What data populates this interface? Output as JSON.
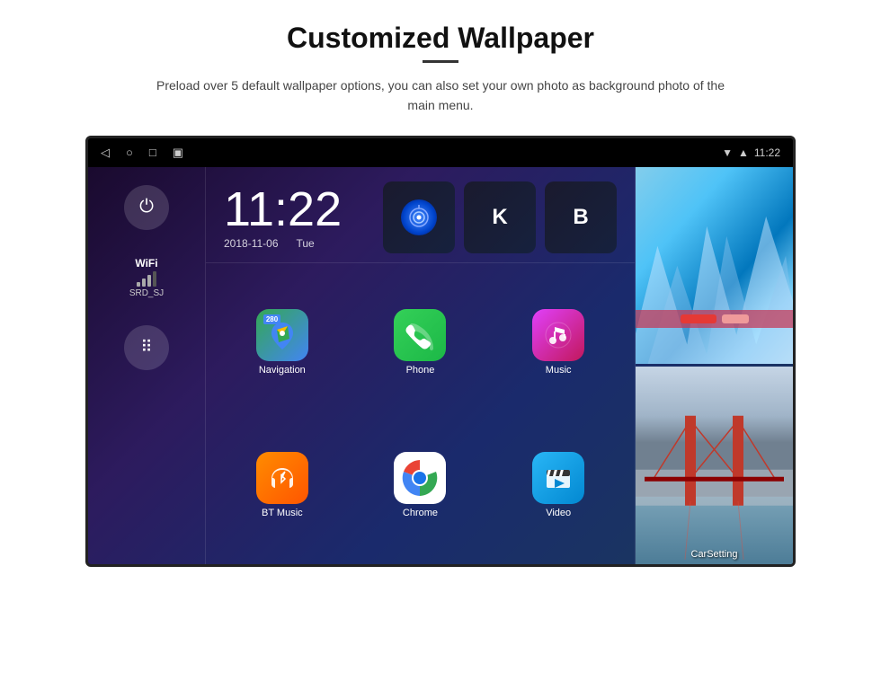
{
  "header": {
    "title": "Customized Wallpaper",
    "description": "Preload over 5 default wallpaper options, you can also set your own photo as background photo of the main menu."
  },
  "status_bar": {
    "time": "11:22",
    "nav_icons": [
      "◁",
      "○",
      "□",
      "▣"
    ]
  },
  "clock": {
    "time": "11:22",
    "date": "2018-11-06",
    "day": "Tue"
  },
  "wifi": {
    "label": "WiFi",
    "ssid": "SRD_SJ"
  },
  "apps": [
    {
      "name": "Navigation",
      "icon_type": "maps"
    },
    {
      "name": "Phone",
      "icon_type": "phone"
    },
    {
      "name": "Music",
      "icon_type": "music"
    },
    {
      "name": "BT Music",
      "icon_type": "bt"
    },
    {
      "name": "Chrome",
      "icon_type": "chrome"
    },
    {
      "name": "Video",
      "icon_type": "video"
    }
  ],
  "wallpapers": [
    {
      "label": ""
    },
    {
      "label": "CarSetting"
    }
  ]
}
